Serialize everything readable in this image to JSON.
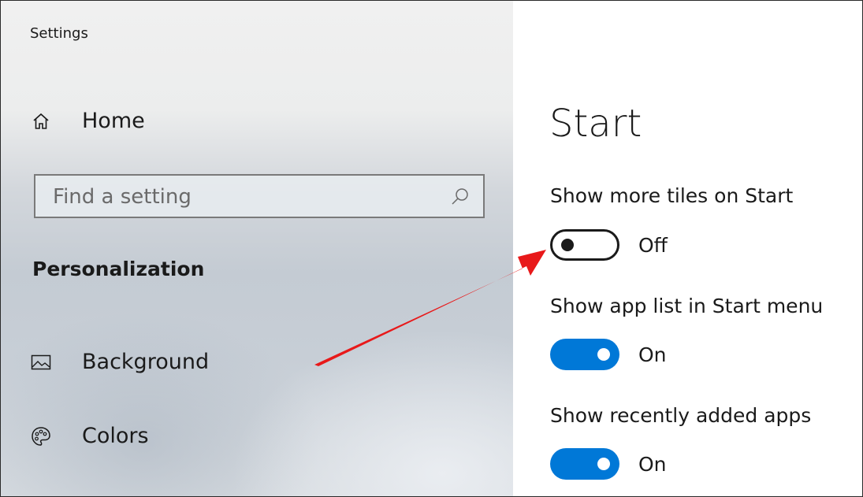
{
  "window": {
    "title": "Settings"
  },
  "sidebar": {
    "home": {
      "label": "Home",
      "icon": "home-icon"
    },
    "search": {
      "placeholder": "Find a setting",
      "icon": "search-icon"
    },
    "section_title": "Personalization",
    "items": [
      {
        "label": "Background",
        "icon": "picture-icon"
      },
      {
        "label": "Colors",
        "icon": "palette-icon"
      }
    ]
  },
  "main": {
    "title": "Start",
    "settings": [
      {
        "label": "Show more tiles on Start",
        "state": "Off"
      },
      {
        "label": "Show app list in Start menu",
        "state": "On"
      },
      {
        "label": "Show recently added apps",
        "state": "On"
      }
    ]
  },
  "colors": {
    "accent": "#0078d7",
    "annotation_arrow": "#e8191a"
  }
}
